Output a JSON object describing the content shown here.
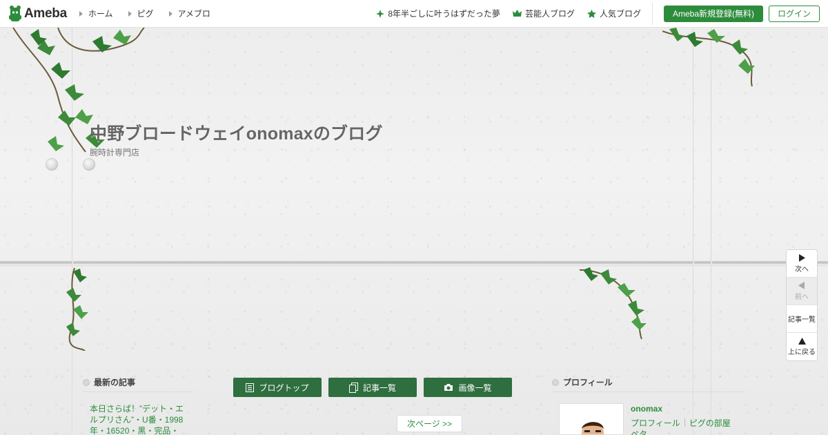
{
  "header": {
    "logo_text": "Ameba",
    "nav_left": [
      {
        "label": "ホーム"
      },
      {
        "label": "ピグ"
      },
      {
        "label": "アメブロ"
      }
    ],
    "nav_right": [
      {
        "label": "8年半ごしに叶うはずだった夢",
        "icon": "sparkle-icon"
      },
      {
        "label": "芸能人ブログ",
        "icon": "crown-icon"
      },
      {
        "label": "人気ブログ",
        "icon": "star-icon"
      }
    ],
    "register_label": "Ameba新規登録(無料)",
    "login_label": "ログイン"
  },
  "blog": {
    "title": "中野ブロードウェイonomaxのブログ",
    "description": "腕時計専門店"
  },
  "side_pager": {
    "next_label": "次へ",
    "prev_label": "前へ",
    "list_label": "記事一覧",
    "top_label": "上に戻る"
  },
  "latest": {
    "heading": "最新の記事",
    "entry_text": "本日さらば！”デット・エルプリさん”・U番・1998年・16520・黒・完品・"
  },
  "tabs": [
    {
      "label": "ブログトップ",
      "icon": "document-icon"
    },
    {
      "label": "記事一覧",
      "icon": "copy-icon"
    },
    {
      "label": "画像一覧",
      "icon": "camera-icon"
    }
  ],
  "pagination": {
    "next_label": "次ページ >>"
  },
  "profile": {
    "heading": "プロフィール",
    "name": "onomax",
    "link_profile": "プロフィール",
    "link_room": "ピグの部屋",
    "link_beta": "ペタ"
  },
  "colors": {
    "brand_green": "#2d8c3c",
    "tab_green": "#2e6e3f"
  }
}
